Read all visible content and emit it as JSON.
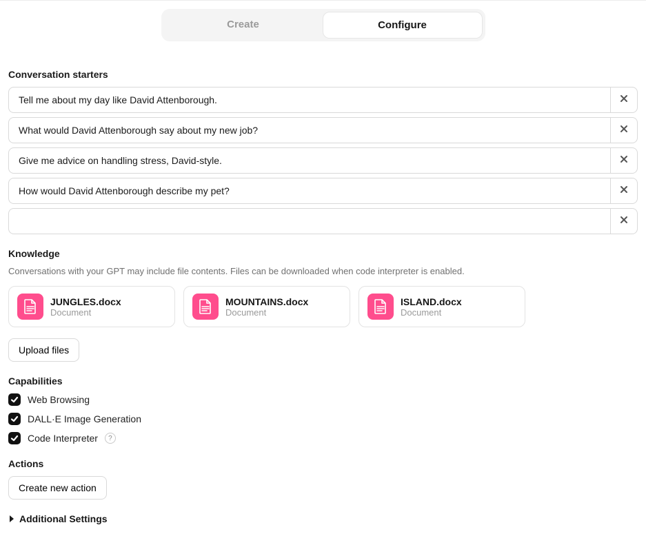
{
  "tabs": {
    "create": "Create",
    "configure": "Configure"
  },
  "starters": {
    "title": "Conversation starters",
    "items": [
      "Tell me about my day like David Attenborough.",
      "What would David Attenborough say about my new job?",
      "Give me advice on handling stress, David-style.",
      "How would David Attenborough describe my pet?",
      ""
    ]
  },
  "knowledge": {
    "title": "Knowledge",
    "note": "Conversations with your GPT may include file contents. Files can be downloaded when code interpreter is enabled.",
    "files": [
      {
        "name": "JUNGLES.docx",
        "type": "Document"
      },
      {
        "name": "MOUNTAINS.docx",
        "type": "Document"
      },
      {
        "name": "ISLAND.docx",
        "type": "Document"
      }
    ],
    "upload_label": "Upload files"
  },
  "capabilities": {
    "title": "Capabilities",
    "items": [
      {
        "label": "Web Browsing",
        "checked": true,
        "help": false
      },
      {
        "label": "DALL·E Image Generation",
        "checked": true,
        "help": false
      },
      {
        "label": "Code Interpreter",
        "checked": true,
        "help": true
      }
    ]
  },
  "actions": {
    "title": "Actions",
    "create_label": "Create new action"
  },
  "additional": {
    "title": "Additional Settings"
  }
}
